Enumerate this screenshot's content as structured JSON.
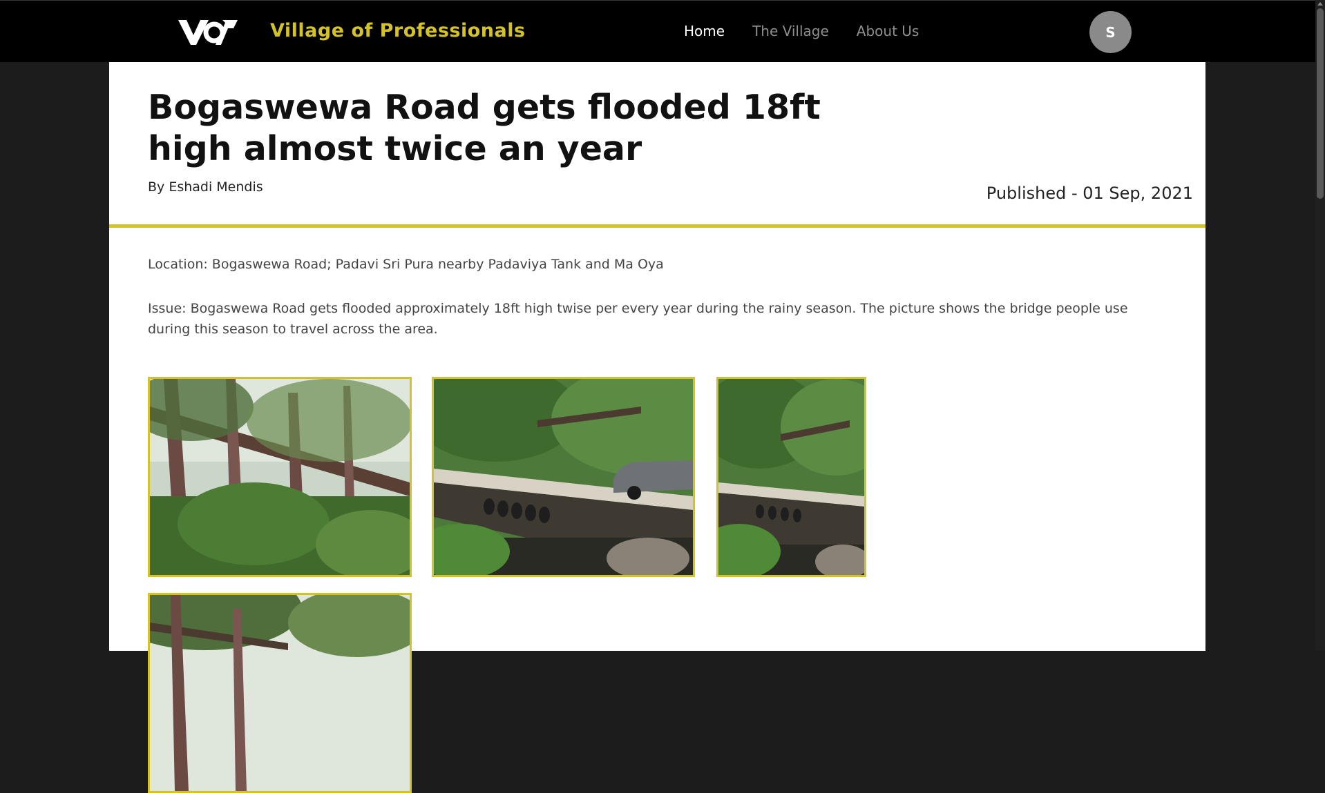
{
  "header": {
    "logo_text": "VoP",
    "brand_name": "Village of Professionals",
    "nav": [
      {
        "label": "Home",
        "active": true
      },
      {
        "label": "The Village",
        "active": false
      },
      {
        "label": "About Us",
        "active": false
      }
    ],
    "avatar_initial": "S"
  },
  "article": {
    "title": "Bogaswewa Road gets flooded 18ft high almost twice an year",
    "author": "By Eshadi Mendis",
    "published": "Published - 01 Sep, 2021",
    "location": "Location: Bogaswewa Road; Padavi Sri Pura nearby Padaviya Tank and Ma Oya",
    "issue": "Issue: Bogaswewa Road gets flooded approximately 18ft high twise per every year during the rainy season. The picture shows the bridge people use during this season to travel across the area."
  },
  "gallery": [
    {
      "subject": "raised walkway among trees"
    },
    {
      "subject": "road culvert with car and stream"
    },
    {
      "subject": "road culvert with stream"
    },
    {
      "subject": "trees and walkway"
    }
  ],
  "colors": {
    "accent": "#d4c22b",
    "navbar_bg": "#000000",
    "page_bg": "#1c1c1c",
    "card_bg": "#ffffff"
  }
}
